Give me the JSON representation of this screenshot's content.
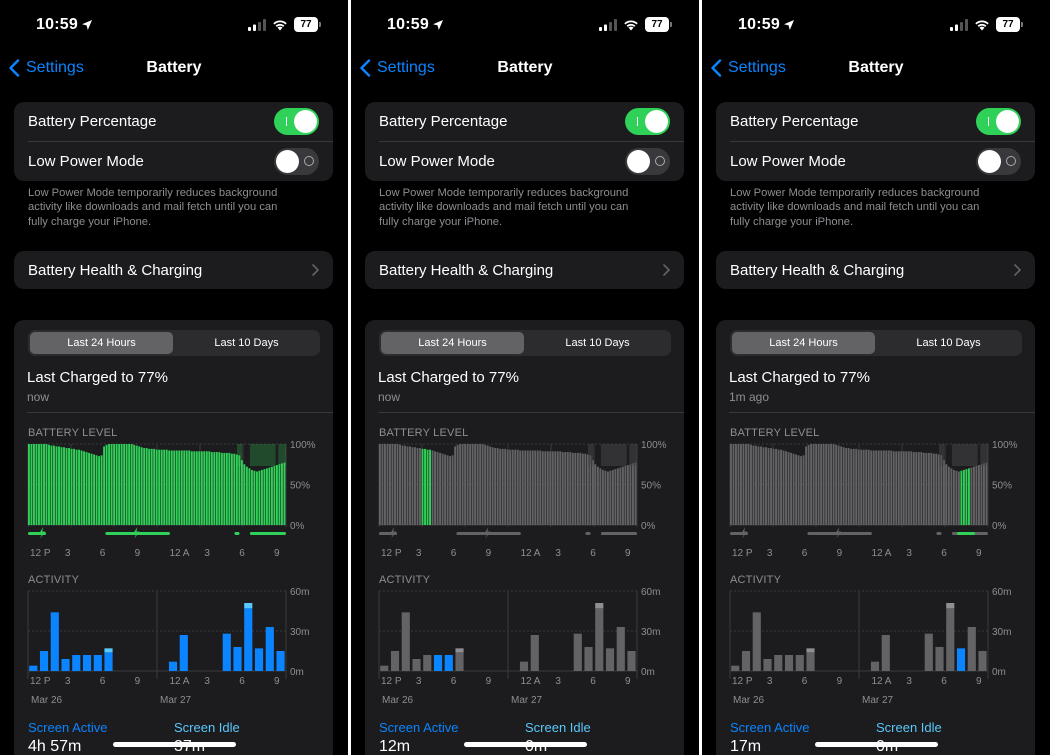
{
  "status": {
    "time": "10:59",
    "battery_level": "77"
  },
  "nav": {
    "back_label": "Settings",
    "title": "Battery"
  },
  "settings": {
    "battery_percentage": {
      "label": "Battery Percentage",
      "enabled": true
    },
    "low_power_mode": {
      "label": "Low Power Mode",
      "enabled": false
    },
    "low_power_note_lines": [
      "Low Power Mode temporarily reduces background",
      "activity like downloads and mail fetch until you can",
      "fully charge your iPhone."
    ],
    "health_label": "Battery Health & Charging"
  },
  "usage": {
    "tabs": [
      "Last 24 Hours",
      "Last 10 Days"
    ],
    "selected_tab": "Last 24 Hours",
    "battery_level_label": "BATTERY LEVEL",
    "activity_label": "ACTIVITY",
    "screen_active_label": "Screen Active",
    "screen_idle_label": "Screen Idle"
  },
  "colors": {
    "accent_blue": "#0a84ff",
    "green": "#30d158",
    "idle_blue": "#5ac8fa",
    "gray_bar": "#555558",
    "dim_bar": "#636366"
  },
  "icons": [
    "chevron-left-icon",
    "location-arrow-icon",
    "cellular-signal-icon",
    "wifi-icon",
    "battery-icon",
    "chevron-right-icon",
    "charging-bolt-icon"
  ],
  "chart_data": [
    {
      "type": "bar",
      "title": "BATTERY LEVEL",
      "panel": "left",
      "x_tick_labels": [
        "12 P",
        "3",
        "6",
        "9",
        "12 A",
        "3",
        "6",
        "9"
      ],
      "y_tick_labels": [
        "100%",
        "50%",
        "0%"
      ],
      "ylim": [
        0,
        100
      ],
      "values": [
        100,
        100,
        100,
        100,
        100,
        100,
        100,
        100,
        99,
        98,
        98,
        97,
        97,
        96,
        96,
        95,
        95,
        94,
        94,
        93,
        93,
        92,
        91,
        90,
        89,
        88,
        87,
        86,
        85,
        86,
        97,
        99,
        100,
        100,
        100,
        100,
        100,
        100,
        100,
        100,
        100,
        100,
        99,
        98,
        97,
        96,
        95,
        95,
        94,
        94,
        94,
        93,
        93,
        93,
        93,
        93,
        92,
        92,
        92,
        92,
        92,
        92,
        92,
        92,
        92,
        91,
        91,
        91,
        91,
        91,
        91,
        91,
        91,
        90,
        90,
        90,
        90,
        89,
        89,
        89,
        89,
        88,
        88,
        87,
        86,
        80,
        75,
        72,
        70,
        68,
        67,
        66,
        67,
        68,
        69,
        70,
        71,
        72,
        73,
        74,
        75,
        76,
        77
      ],
      "highlight_color": "#30d158",
      "charging_markers": [
        "12 P",
        "6"
      ]
    },
    {
      "type": "bar",
      "title": "BATTERY LEVEL",
      "panel": "middle",
      "x_tick_labels": [
        "12 P",
        "3",
        "6",
        "9",
        "12 A",
        "3",
        "6",
        "9"
      ],
      "y_tick_labels": [
        "100%",
        "50%",
        "0%"
      ],
      "ylim": [
        0,
        100
      ],
      "values": [
        100,
        100,
        100,
        100,
        100,
        100,
        100,
        100,
        99,
        98,
        98,
        97,
        97,
        96,
        96,
        95,
        95,
        94,
        94,
        93,
        93,
        92,
        91,
        90,
        89,
        88,
        87,
        86,
        85,
        86,
        97,
        99,
        100,
        100,
        100,
        100,
        100,
        100,
        100,
        100,
        100,
        100,
        99,
        98,
        97,
        96,
        95,
        95,
        94,
        94,
        94,
        93,
        93,
        93,
        93,
        93,
        92,
        92,
        92,
        92,
        92,
        92,
        92,
        92,
        92,
        91,
        91,
        91,
        91,
        91,
        91,
        91,
        91,
        90,
        90,
        90,
        90,
        89,
        89,
        89,
        89,
        88,
        88,
        87,
        86,
        80,
        75,
        72,
        70,
        68,
        67,
        66,
        67,
        68,
        69,
        70,
        71,
        72,
        73,
        74,
        75,
        76,
        77
      ],
      "highlight_color": "#30d158"
    },
    {
      "type": "bar",
      "title": "BATTERY LEVEL",
      "panel": "right",
      "x_tick_labels": [
        "12 P",
        "3",
        "6",
        "9",
        "12 A",
        "3",
        "6",
        "9"
      ],
      "y_tick_labels": [
        "100%",
        "50%",
        "0%"
      ],
      "ylim": [
        0,
        100
      ],
      "values": [
        100,
        100,
        100,
        100,
        100,
        100,
        100,
        100,
        99,
        98,
        98,
        97,
        97,
        96,
        96,
        95,
        95,
        94,
        94,
        93,
        93,
        92,
        91,
        90,
        89,
        88,
        87,
        86,
        85,
        86,
        97,
        99,
        100,
        100,
        100,
        100,
        100,
        100,
        100,
        100,
        100,
        100,
        99,
        98,
        97,
        96,
        95,
        95,
        94,
        94,
        94,
        93,
        93,
        93,
        93,
        93,
        92,
        92,
        92,
        92,
        92,
        92,
        92,
        92,
        92,
        91,
        91,
        91,
        91,
        91,
        91,
        91,
        91,
        90,
        90,
        90,
        90,
        89,
        89,
        89,
        89,
        88,
        88,
        87,
        86,
        80,
        75,
        72,
        70,
        68,
        67,
        66,
        67,
        68,
        69,
        70,
        71,
        72,
        73,
        74,
        75,
        76,
        77
      ],
      "highlight_color": "#30d158"
    },
    {
      "type": "bar",
      "title": "ACTIVITY",
      "x_tick_labels": [
        "12 P",
        "3",
        "6",
        "9",
        "12 A",
        "3",
        "6",
        "9"
      ],
      "date_labels": [
        "Mar 26",
        "Mar 27"
      ],
      "y_tick_labels": [
        "60m",
        "30m",
        "0m"
      ],
      "ylim": [
        0,
        60
      ],
      "unit": "minutes",
      "series": [
        {
          "values": [
            4,
            15,
            44,
            9,
            12,
            12,
            12,
            14,
            0,
            0,
            0,
            0,
            0,
            7,
            27,
            0,
            0,
            0,
            28,
            18,
            47,
            17,
            33,
            15
          ]
        },
        {
          "values": [
            0,
            0,
            0,
            0,
            0,
            0,
            0,
            3,
            0,
            0,
            0,
            0,
            0,
            0,
            0,
            0,
            0,
            0,
            0,
            0,
            4,
            0,
            0,
            0
          ]
        }
      ]
    }
  ],
  "phones": [
    {
      "last_charged": "Last Charged to 77%",
      "since": "now",
      "screen_active_value": "4h 57m",
      "screen_idle_value": "37m"
    },
    {
      "last_charged": "Last Charged to 77%",
      "since": "now",
      "screen_active_value": "12m",
      "screen_idle_value": "0m"
    },
    {
      "last_charged": "Last Charged to 77%",
      "since": "1m ago",
      "screen_active_value": "17m",
      "screen_idle_value": "0m"
    }
  ]
}
